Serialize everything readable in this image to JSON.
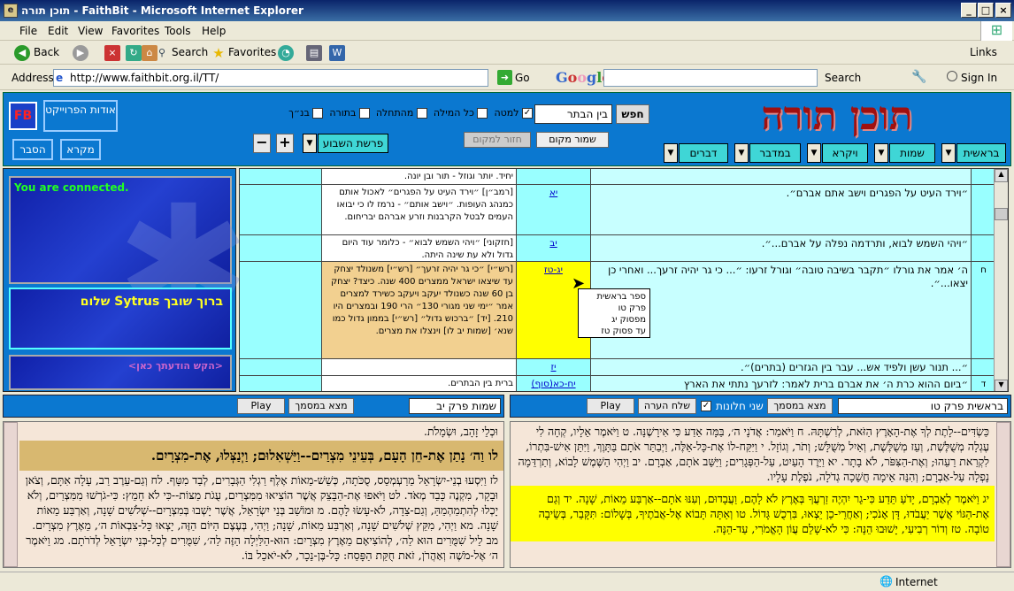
{
  "window": {
    "title": "תוכן תורה - FaithBit - Microsoft Internet Explorer",
    "min": "_",
    "max": "□",
    "close": "×"
  },
  "menu": [
    "File",
    "Edit",
    "View",
    "Favorites",
    "Tools",
    "Help"
  ],
  "toolbar": {
    "back": "Back",
    "search": "Search",
    "favorites": "Favorites"
  },
  "address": {
    "label": "Address",
    "url": "http://www.faithbit.org.il/TT/",
    "go": "Go"
  },
  "google": {
    "logo": "Google",
    "search": "Search",
    "sign_in": "Sign In",
    "links": "Links"
  },
  "header": {
    "logo_title": "תוכן תורה",
    "fb": "FB",
    "about": "אודות הפרוייקט",
    "mikra": "מקרא",
    "hesber": "הסבר",
    "search_btn": "חפש",
    "search_value": "בין הבתר",
    "opts": [
      "למטה",
      "כל המילה",
      "מהתחלה",
      "בתורה",
      "בנ״ך"
    ],
    "save_place": "שמור מקום",
    "return_place": "חזור למקום",
    "parasha": "פרשת השבוע",
    "plus": "+",
    "minus": "−",
    "books": [
      "בראשית",
      "שמות",
      "ויקרא",
      "במדבר",
      "דברים"
    ]
  },
  "left": {
    "connected": "You are connected.",
    "greeting": "ברוך שובך Sytrus שלום",
    "request": "<הקש הודעתך כאן>"
  },
  "grid": {
    "rows": [
      {
        "num": "",
        "ref": "",
        "main": "",
        "comm": "יחיד. יותר וגוזל - תור ובן יונה."
      },
      {
        "num": "",
        "ref": "יא",
        "main": "״וירד העיט על הפגרים וישב אתם אברם״.",
        "comm": "[רמב״ן] ״וירד העיט על הפגרים״ לאכול אותם כמנהג העופות. ״וישב אותם״ - נרמז לו כי יבואו העמים לבטל הקרבנות וזרע אברהם יבריחום."
      },
      {
        "num": "",
        "ref": "יב",
        "main": "״ויהי השמש לבוא, ותרדמה נפלה על אברם...״.",
        "comm": "[חזקוני] ״ויהי השמש לבוא״ - כלומר עוד היום גדול ולא עת שינה היתה."
      },
      {
        "num": "ח",
        "ref": "יג-טז",
        "main": "ה׳ אמר את גורלו ״תקבר בשיבה טובה״ וגורל זרעו: ״... כי גר יהיה זרעך... ואחרי כן יצאו...״.",
        "comm": "[רש״י] ״כי גר יהיה זרעך״ [רש״י] משנולד יצחק עד שיצאו ישראל ממצרים 400 שנה. כיצד? יצחק בן 60 שנה כשנולד יעקב ויעקב כשירד למצרים אמר ״ימי שני מגורי 130״ הרי 190 ובמצרים היו 210. [יד] ״ברכוש גדול״ [רש״י] בממון גדול כמו שנא׳ [שמות יב לו] וינצלו את מצרים."
      },
      {
        "num": "",
        "ref": "יז",
        "main": "״... תנור עשן ולפיד אש... עבר בין הגזרים (בתרים)״.",
        "comm": ""
      },
      {
        "num": "ד",
        "ref": "יח-כא(סוף)",
        "main": "״ביום ההוא כרת ה׳ את אברם ברית לאמר: לזרעך נתתי את הארץ",
        "comm": "ברית בין הבתרים."
      }
    ]
  },
  "tooltip": {
    "lines": [
      "ספר בראשית",
      "פרק טו",
      "מפסוק יג",
      "עד פסוק טז"
    ]
  },
  "bottom_left": {
    "chapter": "שמות פרק יב",
    "find": "מצא במסמך",
    "play": "Play",
    "verses": [
      "וּכְלֵי זָהָב, וּשְׂמָלֹת.",
      "לו וַה׳ נָתַן אֶת-חֵן הָעָם, בְּעֵינֵי מִצְרַיִם--וַיַּשְׁאִלוּם; וַיְנַצְּלוּ, אֶת-מִצְרָיִם.",
      "לז וַיִּסְעוּ בְנֵי-יִשְׂרָאֵל מֵרַעְמְסֵס, סֻכֹּתָה, כְּשֵׁשׁ-מֵאוֹת אֶלֶף רַגְלִי הַגְּבָרִים, לְבַד מִטָּף. לח וְגַם-עֵרֶב רַב, עָלָה אִתָּם, וְצֹאן וּבָקָר, מִקְנֶה כָּבֵד מְאֹד. לט וַיֹּאפוּ אֶת-הַבָּצֵק אֲשֶׁר הוֹצִיאוּ מִמִּצְרַיִם, עֻגֹת מַצּוֹת--כִּי לֹא חָמֵץ: כִּי-גֹרְשׁוּ מִמִּצְרַיִם, וְלֹא יָכְלוּ לְהִתְמַהְמֵהַּ, וְגַם-צֵדָה, לֹא-עָשׂוּ לָהֶם. מ וּמוֹשַׁב בְּנֵי יִשְׂרָאֵל, אֲשֶׁר יָשְׁבוּ בְּמִצְרָיִם--שְׁלֹשִׁים שָׁנָה, וְאַרְבַּע מֵאוֹת שָׁנָה. מא וַיְהִי, מִקֵּץ שְׁלֹשִׁים שָׁנָה, וְאַרְבַּע מֵאוֹת, שָׁנָה; וַיְהִי, בְּעֶצֶם הַיּוֹם הַזֶּה, יָצְאוּ כָּל-צִבְאוֹת ה׳, מֵאֶרֶץ מִצְרָיִם. מב לֵיל שִׁמֻּרִים הוּא לַה׳, לְהוֹצִיאָם מֵאֶרֶץ מִצְרָיִם: הוּא-הַלַּיְלָה הַזֶּה לַה׳, שִׁמֻּרִים לְכָל-בְּנֵי יִשְׂרָאֵל לְדֹרֹתָם. מג וַיֹּאמֶר ה׳ אֶל-מֹשֶׁה וְאַהֲרֹן, זֹאת חֻקַּת הַפָּסַח: כָּל-בֶּן-נֵכָר, לֹא-יֹאכַל בּוֹ."
    ]
  },
  "bottom_right": {
    "chapter": "בראשית פרק טו",
    "find": "מצא במסמך",
    "alt": "שני חלונות",
    "note": "שלח הערה",
    "play": "Play",
    "verses": [
      "כַּשְׂדִּים--לָתֶת לְךָ אֶת-הָאָרֶץ הַזֹּאת, לְרִשְׁתָּהּ. ח וַיֹּאמַר: אֲדֹנָי ה׳, בַּמָּה אֵדַע כִּי אִירָשֶׁנָּה. ט וַיֹּאמֶר אֵלָיו, קְחָה לִי עֶגְלָה מְשֻׁלֶּשֶׁת, וְעֵז מְשֻׁלֶּשֶׁת, וְאַיִל מְשֻׁלָּשׁ; וְתֹר, וְגוֹזָל. י וַיִּקַּח-לוֹ אֶת-כָּל-אֵלֶּה, וַיְבַתֵּר אֹתָם בַּתָּוֶךְ, וַיִּתֵּן אִישׁ-בִּתְרוֹ, לִקְרַאת רֵעֵהוּ; וְאֶת-הַצִּפֹּר, לֹא בָתָר. יא וַיֵּרֶד הָעַיִט, עַל-הַפְּגָרִים; וַיַּשֵּׁב אֹתָם, אַבְרָם. יב וַיְהִי הַשֶּׁמֶשׁ לָבוֹא, וְתַרְדֵּמָה נָפְלָה עַל-אַבְרָם; וְהִנֵּה אֵימָה חֲשֵׁכָה גְדֹלָה, נֹפֶלֶת עָלָיו.",
      "יג וַיֹּאמֶר לְאַבְרָם, יָדֹעַ תֵּדַע כִּי-גֵר יִהְיֶה זַרְעֲךָ בְּאֶרֶץ לֹא לָהֶם, וַעֲבָדוּם, וְעִנּוּ אֹתָם--אַרְבַּע מֵאוֹת, שָׁנָה. יד וְגַם אֶת-הַגּוֹי אֲשֶׁר יַעֲבֹדוּ, דָּן אָנֹכִי; וְאַחֲרֵי-כֵן יֵצְאוּ, בִּרְכֻשׁ גָּדוֹל. טו וְאַתָּה תָּבוֹא אֶל-אֲבֹתֶיךָ, בְּשָׁלוֹם: תִּקָּבֵר, בְּשֵׂיבָה טוֹבָה. טז וְדוֹר רְבִיעִי, יָשׁוּבוּ הֵנָּה: כִּי לֹא-שָׁלֵם עֲוֹן הָאֱמֹרִי, עַד-הֵנָּה."
    ]
  },
  "status": {
    "zone": "Internet"
  }
}
